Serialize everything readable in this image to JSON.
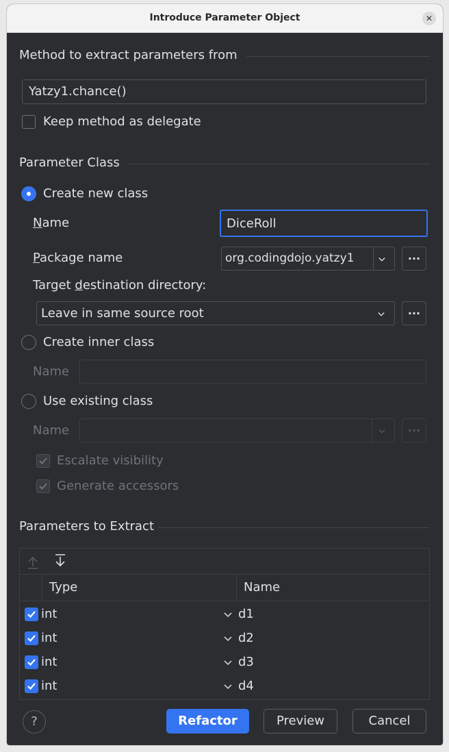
{
  "window": {
    "title": "Introduce Parameter Object"
  },
  "method_section": {
    "header": "Method to extract parameters from",
    "method_value": "Yatzy1.chance()",
    "keep_delegate_label": "Keep method as delegate",
    "keep_delegate_checked": false
  },
  "param_class": {
    "header": "Parameter Class",
    "create_new": {
      "label": "Create new class",
      "selected": true,
      "name_label_first": "N",
      "name_label_rest": "ame",
      "name_value": "DiceRoll",
      "package_label_first": "P",
      "package_label_rest": "ackage name",
      "package_value": "org.codingdojo.yatzy1",
      "target_label_pre": "Target ",
      "target_label_u": "d",
      "target_label_post": "estination directory:",
      "target_value": "Leave in same source root",
      "browse": "..."
    },
    "create_inner": {
      "label": "Create inner class",
      "selected": false,
      "name_label": "Name",
      "name_value": ""
    },
    "use_existing": {
      "label": "Use existing class",
      "selected": false,
      "name_label": "Name",
      "name_value": "",
      "browse": "...",
      "escalate_label": "Escalate visibility",
      "generate_label": "Generate accessors"
    }
  },
  "params": {
    "header": "Parameters to Extract",
    "columns": {
      "type": "Type",
      "name": "Name"
    },
    "rows": [
      {
        "checked": true,
        "type": "int",
        "name": "d1"
      },
      {
        "checked": true,
        "type": "int",
        "name": "d2"
      },
      {
        "checked": true,
        "type": "int",
        "name": "d3"
      },
      {
        "checked": true,
        "type": "int",
        "name": "d4"
      }
    ]
  },
  "buttons": {
    "help": "?",
    "refactor": "Refactor",
    "preview": "Preview",
    "cancel": "Cancel"
  },
  "colors": {
    "accent": "#3574f0",
    "background": "#2b2d30",
    "titlebar": "#f3f3f3"
  }
}
